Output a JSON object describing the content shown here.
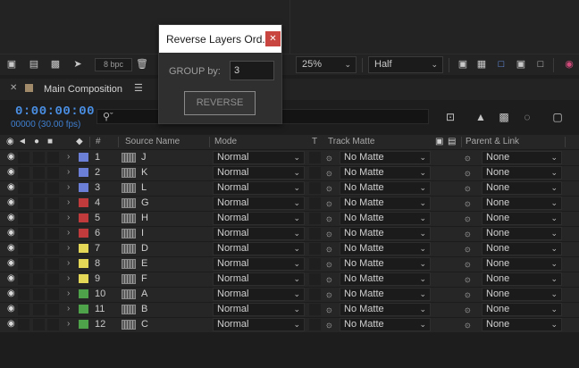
{
  "dialog": {
    "title": "Reverse Layers Ord...",
    "close_icon": "close-icon",
    "group_label": "GROUP by:",
    "group_value": "3",
    "reverse_label": "REVERSE"
  },
  "viewer_toolbar": {
    "bpc_label": "8 bpc",
    "zoom_value": "25%",
    "resolution_value": "Half"
  },
  "timeline": {
    "comp_name": "Main Composition",
    "timecode": "0:00:00:00",
    "frame_fps": "00000 (30.00 fps)",
    "menu_icon": "hamburger-menu-icon",
    "swatch_color": "#a08a6a"
  },
  "columns": {
    "hash": "#",
    "source_name": "Source Name",
    "mode": "Mode",
    "t": "T",
    "track_matte": "Track Matte",
    "parent_link": "Parent & Link"
  },
  "label_colors": {
    "blue": "#6c7fd6",
    "red": "#c03b3b",
    "yellow": "#e4d757",
    "green": "#4ea34a"
  },
  "layers": [
    {
      "num": "1",
      "name": "J",
      "color": "#6c7fd6",
      "mode": "Normal",
      "matte": "No Matte",
      "parent": "None"
    },
    {
      "num": "2",
      "name": "K",
      "color": "#6c7fd6",
      "mode": "Normal",
      "matte": "No Matte",
      "parent": "None"
    },
    {
      "num": "3",
      "name": "L",
      "color": "#6c7fd6",
      "mode": "Normal",
      "matte": "No Matte",
      "parent": "None"
    },
    {
      "num": "4",
      "name": "G",
      "color": "#c03b3b",
      "mode": "Normal",
      "matte": "No Matte",
      "parent": "None"
    },
    {
      "num": "5",
      "name": "H",
      "color": "#c03b3b",
      "mode": "Normal",
      "matte": "No Matte",
      "parent": "None"
    },
    {
      "num": "6",
      "name": "I",
      "color": "#c03b3b",
      "mode": "Normal",
      "matte": "No Matte",
      "parent": "None"
    },
    {
      "num": "7",
      "name": "D",
      "color": "#e4d757",
      "mode": "Normal",
      "matte": "No Matte",
      "parent": "None"
    },
    {
      "num": "8",
      "name": "E",
      "color": "#e4d757",
      "mode": "Normal",
      "matte": "No Matte",
      "parent": "None"
    },
    {
      "num": "9",
      "name": "F",
      "color": "#e4d757",
      "mode": "Normal",
      "matte": "No Matte",
      "parent": "None"
    },
    {
      "num": "10",
      "name": "A",
      "color": "#4ea34a",
      "mode": "Normal",
      "matte": "No Matte",
      "parent": "None"
    },
    {
      "num": "11",
      "name": "B",
      "color": "#4ea34a",
      "mode": "Normal",
      "matte": "No Matte",
      "parent": "None"
    },
    {
      "num": "12",
      "name": "C",
      "color": "#4ea34a",
      "mode": "Normal",
      "matte": "No Matte",
      "parent": "None"
    }
  ]
}
